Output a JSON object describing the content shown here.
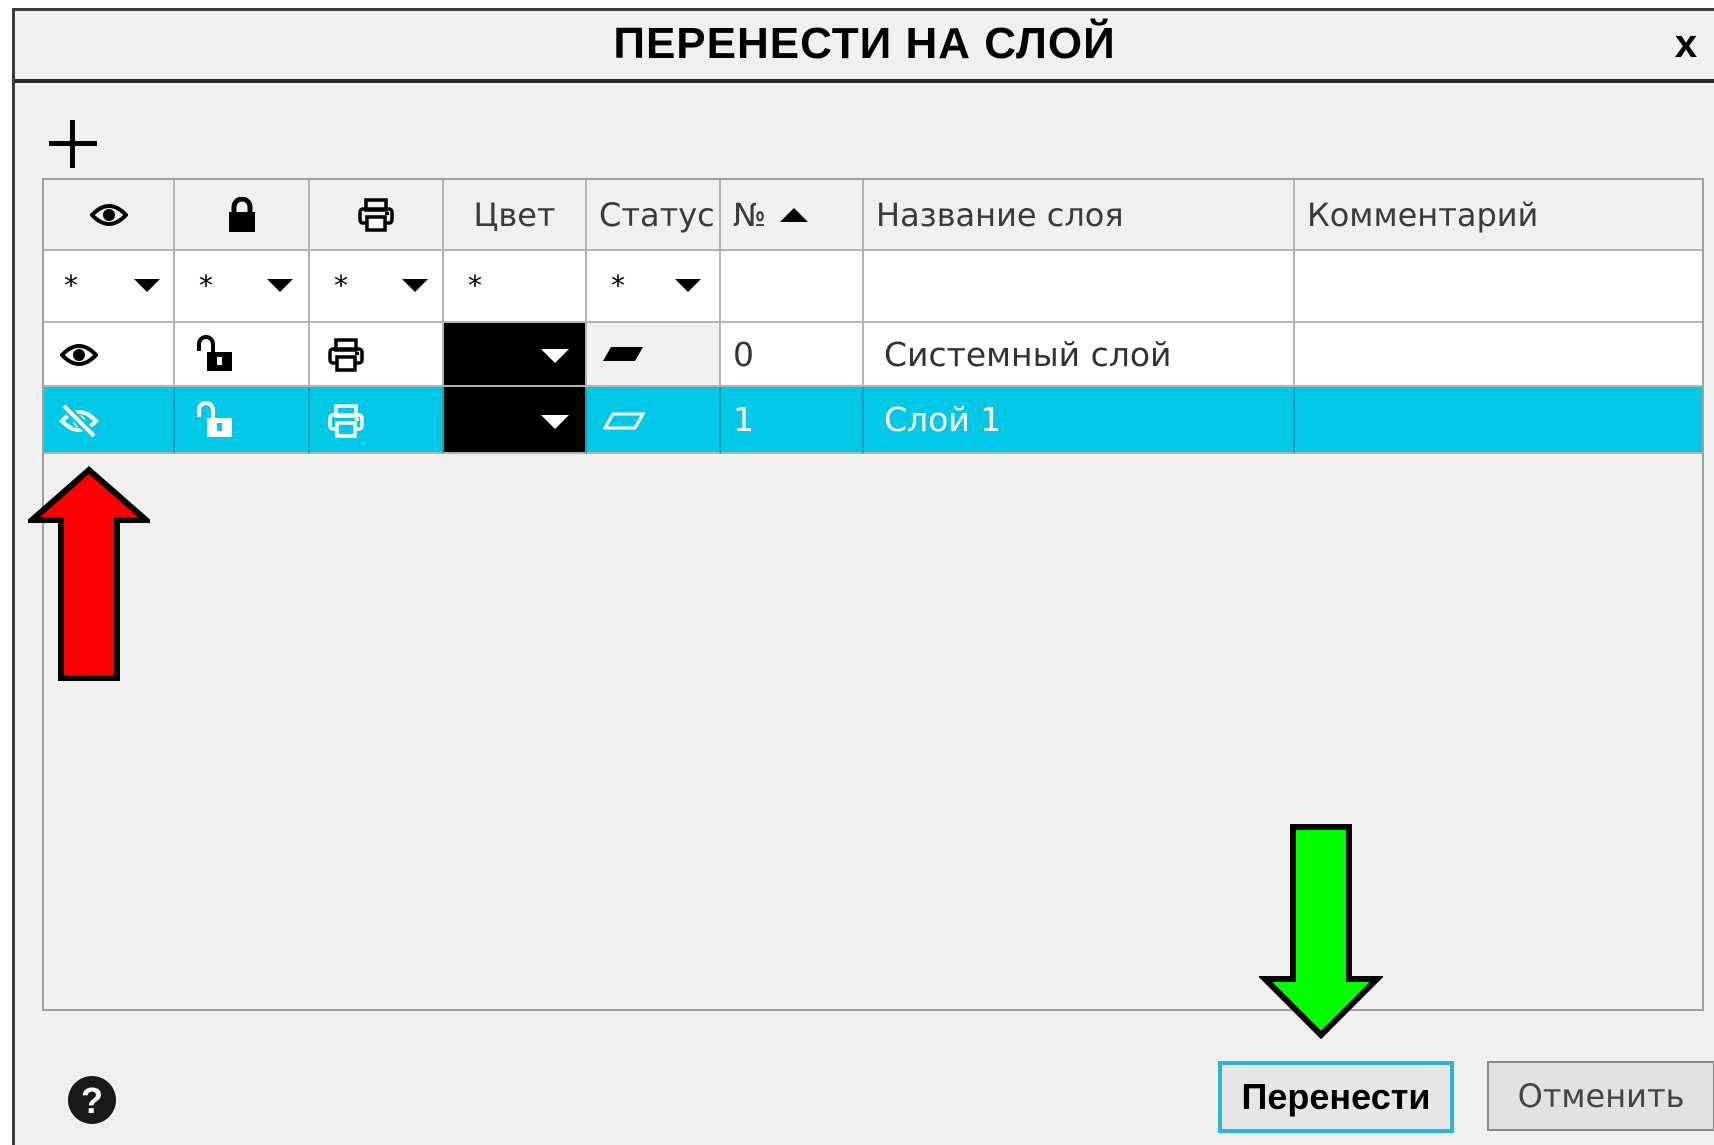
{
  "dialog": {
    "title": "ПЕРЕНЕСТИ НА СЛОЙ",
    "close_label": "x"
  },
  "toolbar": {
    "add_icon": "plus-icon"
  },
  "table": {
    "columns": [
      {
        "key": "visible",
        "icon": "eye-icon"
      },
      {
        "key": "locked",
        "icon": "lock-icon"
      },
      {
        "key": "print",
        "icon": "printer-icon"
      },
      {
        "key": "color",
        "label": "Цвет"
      },
      {
        "key": "status",
        "label": "Статус"
      },
      {
        "key": "number",
        "label": "№",
        "sort": "ascending"
      },
      {
        "key": "name",
        "label": "Название слоя"
      },
      {
        "key": "comment",
        "label": "Комментарий"
      }
    ],
    "filter": {
      "visible": "*",
      "locked": "*",
      "print": "*",
      "color": "*",
      "status": "*"
    },
    "rows": [
      {
        "visible": "eye-open",
        "locked": "unlocked",
        "print": "printer",
        "color": "#000000",
        "status": "filled-parallelogram",
        "number": "0",
        "name": "Системный слой",
        "comment": "",
        "selected": false
      },
      {
        "visible": "eye-hidden",
        "locked": "unlocked",
        "print": "printer",
        "color": "#000000",
        "status": "outline-parallelogram",
        "number": "1",
        "name": "Слой 1",
        "comment": "",
        "selected": true
      }
    ]
  },
  "footer": {
    "help_icon": "question-circle-icon",
    "move_button": "Перенести",
    "cancel_button": "Отменить"
  },
  "annotations": {
    "red_arrow": "arrow-up",
    "green_arrow": "arrow-down"
  },
  "colors": {
    "selection": "#00c8e6",
    "button_focus": "#29b6d6",
    "red_arrow": "#ff0000",
    "green_arrow": "#00ff00"
  }
}
